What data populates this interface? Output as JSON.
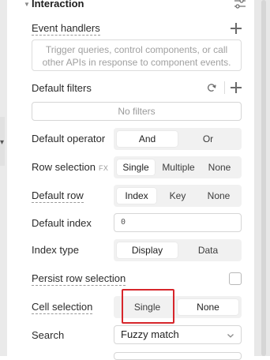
{
  "section": {
    "title": "Interaction",
    "settings_icon": "sliders-icon",
    "caret_icon": "caret-down-icon"
  },
  "event_handlers": {
    "label": "Event handlers",
    "add_icon": "plus-icon",
    "hint": "Trigger queries, control components, or call other APIs in response to component events."
  },
  "default_filters": {
    "label": "Default filters",
    "reset_icon": "redo-icon",
    "add_icon": "plus-icon",
    "empty_text": "No filters"
  },
  "default_operator": {
    "label": "Default operator",
    "options": [
      "And",
      "Or"
    ],
    "selected": "And"
  },
  "row_selection": {
    "label": "Row selection",
    "fx": "FX",
    "options": [
      "Single",
      "Multiple",
      "None"
    ],
    "selected": "Single"
  },
  "default_row": {
    "label": "Default row",
    "options": [
      "Index",
      "Key",
      "None"
    ],
    "selected": "Index"
  },
  "default_index": {
    "label": "Default index",
    "value": "0"
  },
  "index_type": {
    "label": "Index type",
    "options": [
      "Display",
      "Data"
    ],
    "selected": "Display"
  },
  "persist_row_selection": {
    "label": "Persist row selection",
    "checked": false
  },
  "cell_selection": {
    "label": "Cell selection",
    "options": [
      "Single",
      "None"
    ],
    "selected": "None"
  },
  "search": {
    "label": "Search",
    "value": "Fuzzy match",
    "chevron_icon": "chevron-down-icon"
  },
  "colors": {
    "highlight": "#d7262b",
    "segment_bg": "#f1f1f1"
  }
}
